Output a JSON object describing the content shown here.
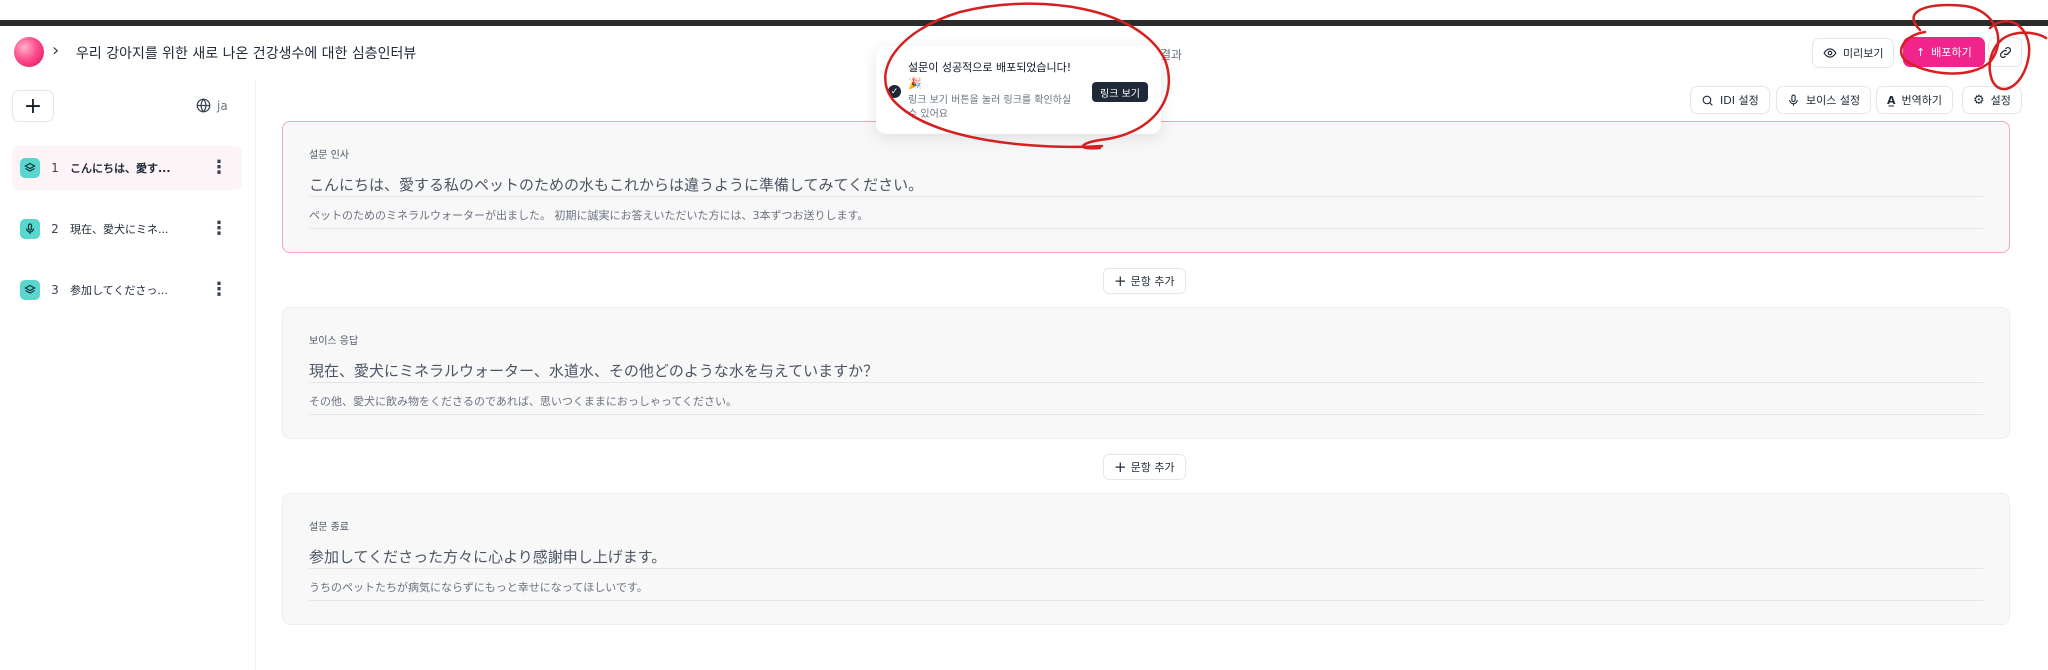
{
  "header": {
    "title": "우리 강아지를 위한 새로 나온 건강생수에 대한 심층인터뷰",
    "result_tab": "결과",
    "preview_label": "미리보기",
    "deploy_label": "배포하기"
  },
  "sidebar": {
    "language": "ja",
    "items": [
      {
        "num": "1",
        "label": "こんにちは、愛す...",
        "icon": "layers-icon"
      },
      {
        "num": "2",
        "label": "現在、愛犬にミネ...",
        "icon": "mic-icon"
      },
      {
        "num": "3",
        "label": "参加してくださっ...",
        "icon": "layers-icon"
      }
    ]
  },
  "toolbar": {
    "idi_settings": "IDI 설정",
    "voice_settings": "보이스 설정",
    "translate": "번역하기",
    "settings": "설정"
  },
  "cards": [
    {
      "label": "설문 인사",
      "question": "こんにちは、愛する私のペットのための水もこれからは違うように準備してみてください。",
      "description": "ペットのためのミネラルウォーターが出ました。 初期に誠実にお答えいただいた方には、3本ずつお送りします。"
    },
    {
      "label": "보이스 응답",
      "question": "現在、愛犬にミネラルウォーター、水道水、その他どのような水を与えていますか？",
      "description": "その他、愛犬に飲み物をくださるのであれば、思いつくままにおっしゃってください。"
    },
    {
      "label": "설문 종료",
      "question": "参加してくださった方々に心より感謝申し上げます。",
      "description": "うちのペットたちが病気にならずにもっと幸せになってほしいです。"
    }
  ],
  "add_question_label": "문항 추가",
  "toast": {
    "title": "설문이 성공적으로 배포되었습니다! 🎉",
    "description": "링크 보기 버튼을 눌러 링크를 확인하실 수 있어요",
    "button": "링크 보기"
  },
  "colors": {
    "accent": "#f0248a",
    "icon_bg": "#5ad6cf",
    "annotation": "#d42020"
  }
}
